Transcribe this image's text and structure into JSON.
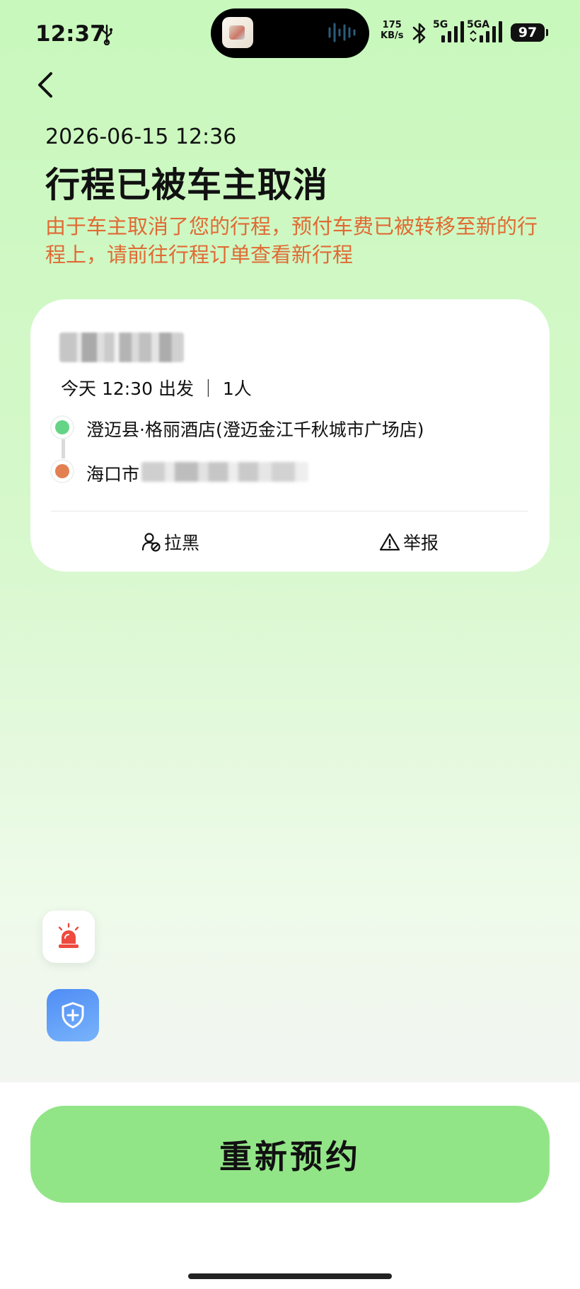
{
  "status_bar": {
    "time": "12:37",
    "net_speed_value": "175",
    "net_speed_unit": "KB/s",
    "signal1_label": "5G",
    "signal2_label": "5GA",
    "battery": "97"
  },
  "header": {
    "datetime": "2026-06-15 12:36",
    "title": "行程已被车主取消",
    "notice": "由于车主取消了您的行程，预付车费已被转移至新的行程上，请前往行程订单查看新行程"
  },
  "trip_card": {
    "departure": "今天 12:30 出发 ｜ 1人",
    "start_address": "澄迈县·格丽酒店(澄迈金江千秋城市广场店)",
    "end_city": "海口市",
    "actions": {
      "block_label": "拉黑",
      "report_label": "举报"
    }
  },
  "bottom": {
    "rebook_label": "重新预约"
  },
  "colors": {
    "notice": "#e06a34",
    "primary_button": "#92e587",
    "start_dot": "#66d487",
    "end_dot": "#e28052",
    "sos": "#ee4a3f",
    "safety": "#4f8df5"
  }
}
